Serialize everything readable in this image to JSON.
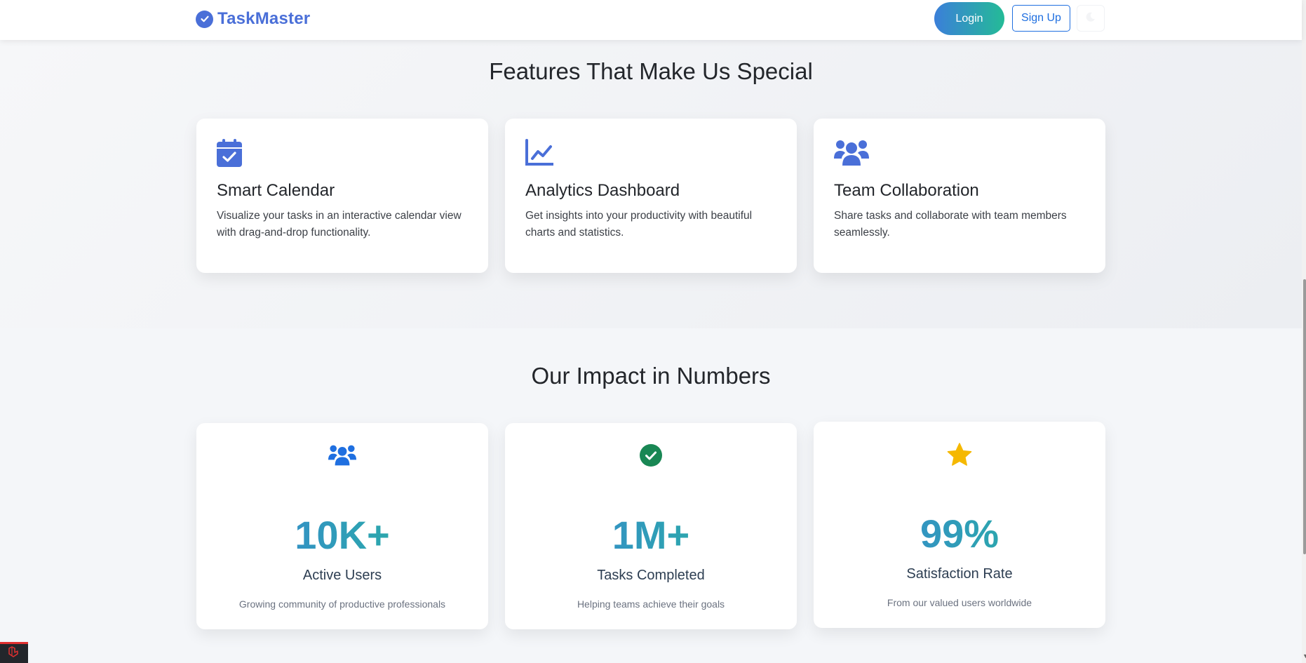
{
  "navbar": {
    "brand_name": "TaskMaster",
    "login_label": "Login",
    "signup_label": "Sign Up"
  },
  "features": {
    "title": "Features That Make Us Special",
    "cards": [
      {
        "icon": "calendar-check-icon",
        "title": "Smart Calendar",
        "description": "Visualize your tasks in an interactive calendar view with drag-and-drop functionality."
      },
      {
        "icon": "chart-line-icon",
        "title": "Analytics Dashboard",
        "description": "Get insights into your productivity with beautiful charts and statistics."
      },
      {
        "icon": "users-icon",
        "title": "Team Collaboration",
        "description": "Share tasks and collaborate with team members seamlessly."
      }
    ]
  },
  "stats": {
    "title": "Our Impact in Numbers",
    "cards": [
      {
        "icon": "users-icon",
        "value": "10K+",
        "label": "Active Users",
        "description": "Growing community of productive professionals"
      },
      {
        "icon": "check-circle-icon",
        "value": "1M+",
        "label": "Tasks Completed",
        "description": "Helping teams achieve their goals"
      },
      {
        "icon": "star-icon",
        "value": "99%",
        "label": "Satisfaction Rate",
        "description": "From our valued users worldwide"
      }
    ]
  },
  "colors": {
    "brand": "#4a6fd8",
    "gradient_start": "#3b7fd9",
    "gradient_end": "#24bb97",
    "stat_users_icon": "#1f6fe0",
    "stat_check_icon": "#198754",
    "stat_star_icon": "#f5b800"
  }
}
